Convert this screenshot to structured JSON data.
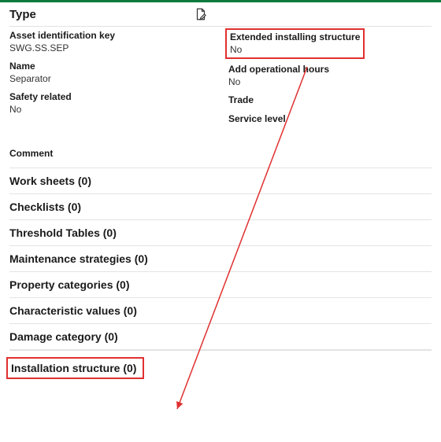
{
  "header": {
    "title": "Type"
  },
  "left": {
    "asset_id_label": "Asset identification key",
    "asset_id_value": "SWG.SS.SEP",
    "name_label": "Name",
    "name_value": "Separator",
    "safety_label": "Safety related",
    "safety_value": "No"
  },
  "right": {
    "ext_label": "Extended installing structure",
    "ext_value": "No",
    "opr_label": "Add operational hours",
    "opr_value": "No",
    "trade_label": "Trade",
    "trade_value": "",
    "service_label": "Service level",
    "service_value": ""
  },
  "comment_label": "Comment",
  "sections": {
    "worksheets": "Work sheets (0)",
    "checklists": "Checklists (0)",
    "threshold": "Threshold Tables (0)",
    "maintenance": "Maintenance strategies (0)",
    "property": "Property categories (0)",
    "characteristic": "Characteristic values (0)",
    "damage": "Damage category (0)",
    "installation": "Installation structure (0)"
  }
}
